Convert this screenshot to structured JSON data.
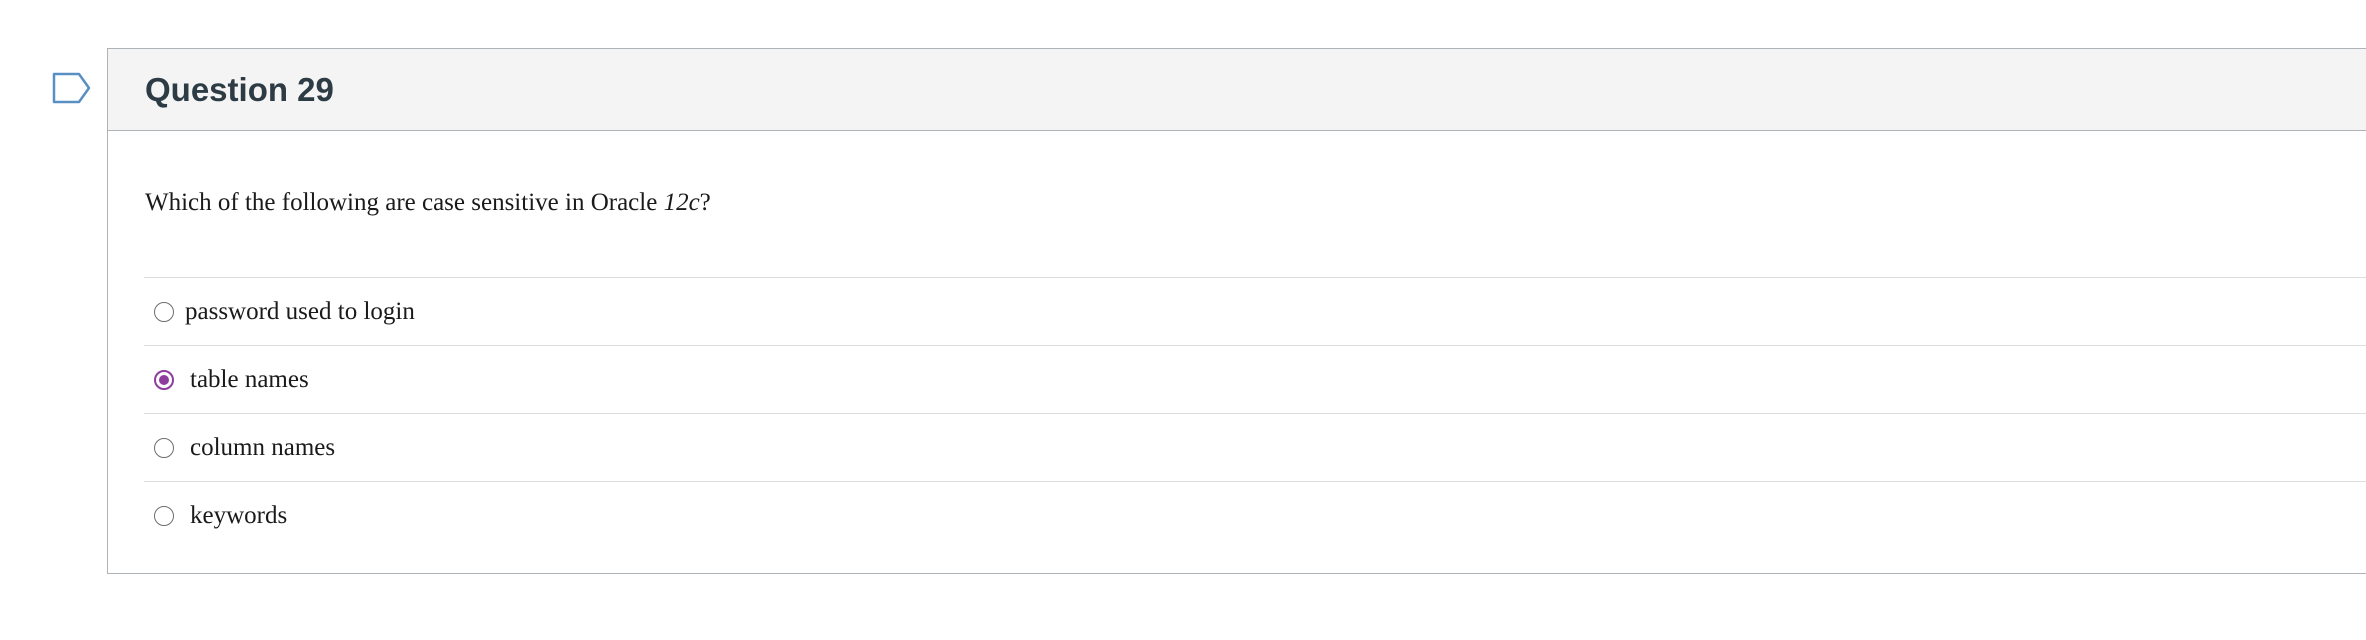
{
  "question": {
    "title": "Question 29",
    "text_before": "Which of the following are case sensitive in Oracle ",
    "text_italic": "12c",
    "text_after": "?",
    "answers": [
      {
        "label": "password used to login",
        "selected": false
      },
      {
        "label": "table names",
        "selected": true
      },
      {
        "label": "column names",
        "selected": false
      },
      {
        "label": "keywords",
        "selected": false
      }
    ]
  },
  "colors": {
    "header_bg": "#f4f4f4",
    "title": "#2d3b45",
    "radio_selected": "#8e3d9e",
    "flag_icon": "#5a8fc4"
  },
  "icons": {
    "flag": "bookmark-flag-icon"
  }
}
